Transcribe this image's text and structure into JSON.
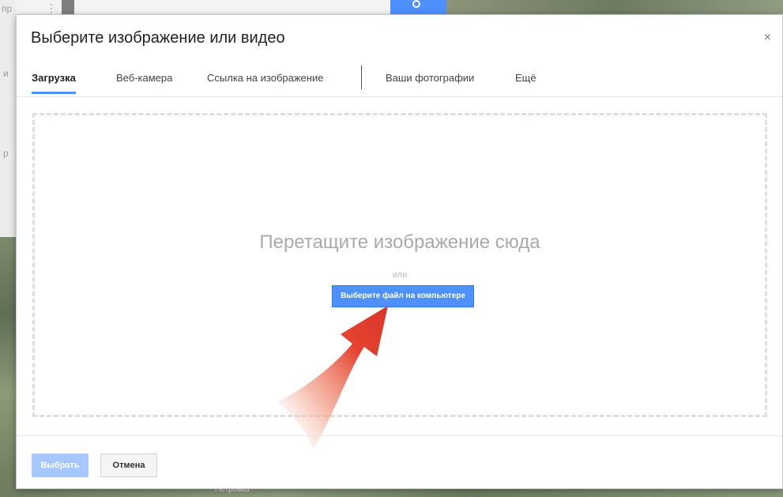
{
  "background": {
    "street_label": "Петровка",
    "partial_text_1": "пр",
    "partial_text_2": "и",
    "partial_text_3": "р"
  },
  "dialog": {
    "title": "Выберите изображение или видео",
    "close_glyph": "×",
    "tabs": [
      {
        "label": "Загрузка",
        "active": true
      },
      {
        "label": "Веб-камера",
        "active": false
      },
      {
        "label": "Ссылка на изображение",
        "active": false
      },
      {
        "label": "Ваши фотографии",
        "active": false
      },
      {
        "label": "Ещё",
        "active": false
      }
    ],
    "dropzone": {
      "prompt": "Перетащите изображение сюда",
      "or_text": "или",
      "choose_button": "Выберите файл на компьютере"
    },
    "footer": {
      "select_button": "Выбрать",
      "cancel_button": "Отмена"
    }
  },
  "colors": {
    "accent": "#4d90fe",
    "arrow": "#d9362b"
  },
  "icons": {
    "close": "close-icon",
    "search": "search-icon",
    "arrow": "arrow-pointer-annotation"
  }
}
